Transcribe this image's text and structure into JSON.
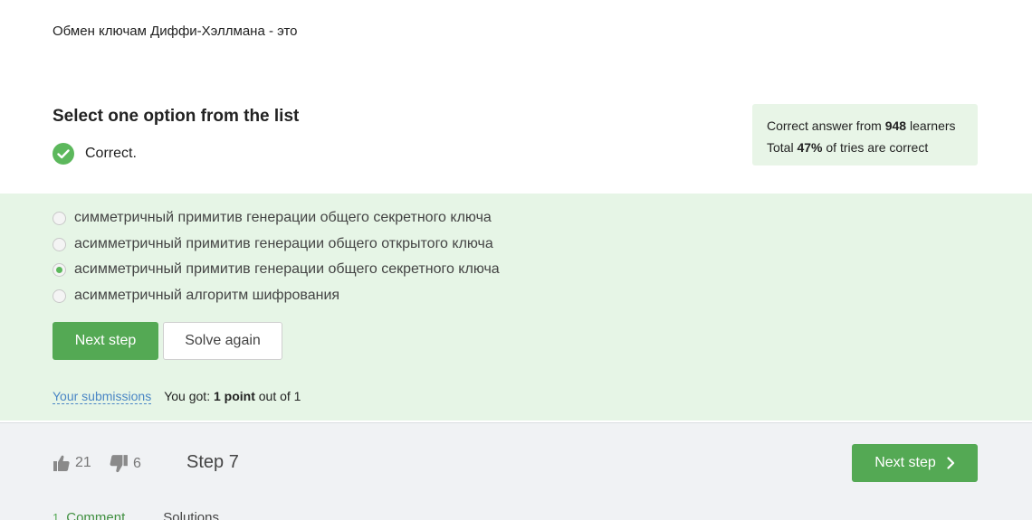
{
  "question": {
    "text": "Обмен ключам Диффи-Хэллмана - это"
  },
  "task": {
    "title": "Select one option from the list",
    "status": "Correct."
  },
  "stats": {
    "line1_prefix": "Correct answer from",
    "learners_count": "948",
    "line1_suffix": "learners",
    "line2_prefix": "Total",
    "percent": "47%",
    "line2_suffix": "of tries are correct"
  },
  "options": [
    {
      "label": "симметричный примитив генерации общего секретного ключа",
      "selected": false
    },
    {
      "label": "асимметричный примитив генерации общего открытого ключа",
      "selected": false
    },
    {
      "label": "асимметричный примитив генерации общего секретного ключа",
      "selected": true
    },
    {
      "label": "асимметричный алгоритм шифрования",
      "selected": false
    }
  ],
  "buttons": {
    "next_step": "Next step",
    "solve_again": "Solve again"
  },
  "submissions": {
    "link": "Your submissions",
    "got_prefix": "You got:",
    "points": "1 point",
    "got_suffix": "out of 1"
  },
  "footer": {
    "likes": "21",
    "dislikes": "6",
    "step_label": "Step 7",
    "next_step": "Next step",
    "comments_count": "1",
    "comments_tab": "Comment",
    "solutions_tab": "Solutions"
  },
  "colors": {
    "accent_green": "#54a954",
    "answer_bg": "#e6f5e6",
    "link_blue": "#4a86c5"
  }
}
